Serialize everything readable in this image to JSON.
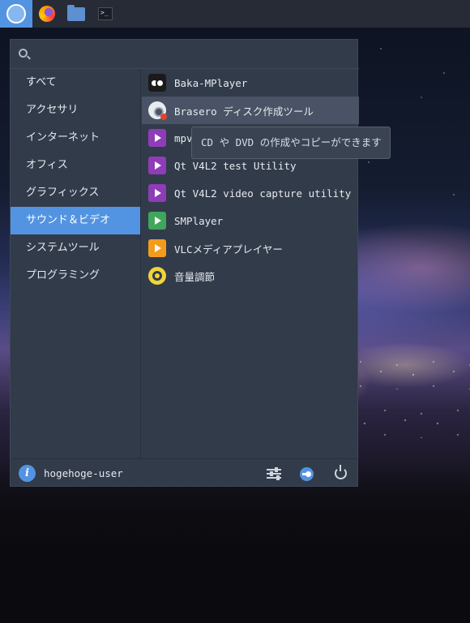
{
  "taskbar": {
    "items": [
      {
        "icon": "start-menu-icon",
        "active": true
      },
      {
        "icon": "firefox-icon",
        "active": false
      },
      {
        "icon": "file-manager-icon",
        "active": false
      },
      {
        "icon": "terminal-icon",
        "active": false,
        "glyph": ">_"
      }
    ]
  },
  "menu": {
    "search": {
      "placeholder": "",
      "value": ""
    },
    "categories": [
      {
        "label": "すべて",
        "selected": false
      },
      {
        "label": "アクセサリ",
        "selected": false
      },
      {
        "label": "インターネット",
        "selected": false
      },
      {
        "label": "オフィス",
        "selected": false
      },
      {
        "label": "グラフィックス",
        "selected": false
      },
      {
        "label": "サウンド＆ビデオ",
        "selected": true
      },
      {
        "label": "システムツール",
        "selected": false
      },
      {
        "label": "プログラミング",
        "selected": false
      }
    ],
    "apps": [
      {
        "label": "Baka-MPlayer",
        "icon": "owl-icon"
      },
      {
        "label": "Brasero ディスク作成ツール",
        "icon": "disc-burner-icon",
        "hovered": true
      },
      {
        "label": "mpv",
        "icon": "video-player-icon"
      },
      {
        "label": "Qt V4L2 test Utility",
        "icon": "video-player-icon"
      },
      {
        "label": "Qt V4L2 video capture utility",
        "icon": "video-player-icon"
      },
      {
        "label": "SMPlayer",
        "icon": "video-player-icon"
      },
      {
        "label": "VLCメディアプレイヤー",
        "icon": "video-player-icon"
      },
      {
        "label": "音量調節",
        "icon": "volume-icon"
      }
    ],
    "tooltip": "CD や DVD の作成やコピーができます",
    "footer": {
      "username": "hogehoge-user",
      "info_glyph": "i"
    }
  },
  "colors": {
    "accent": "#5294e2",
    "menu_bg": "#323b4a",
    "taskbar_bg": "#262b36"
  }
}
